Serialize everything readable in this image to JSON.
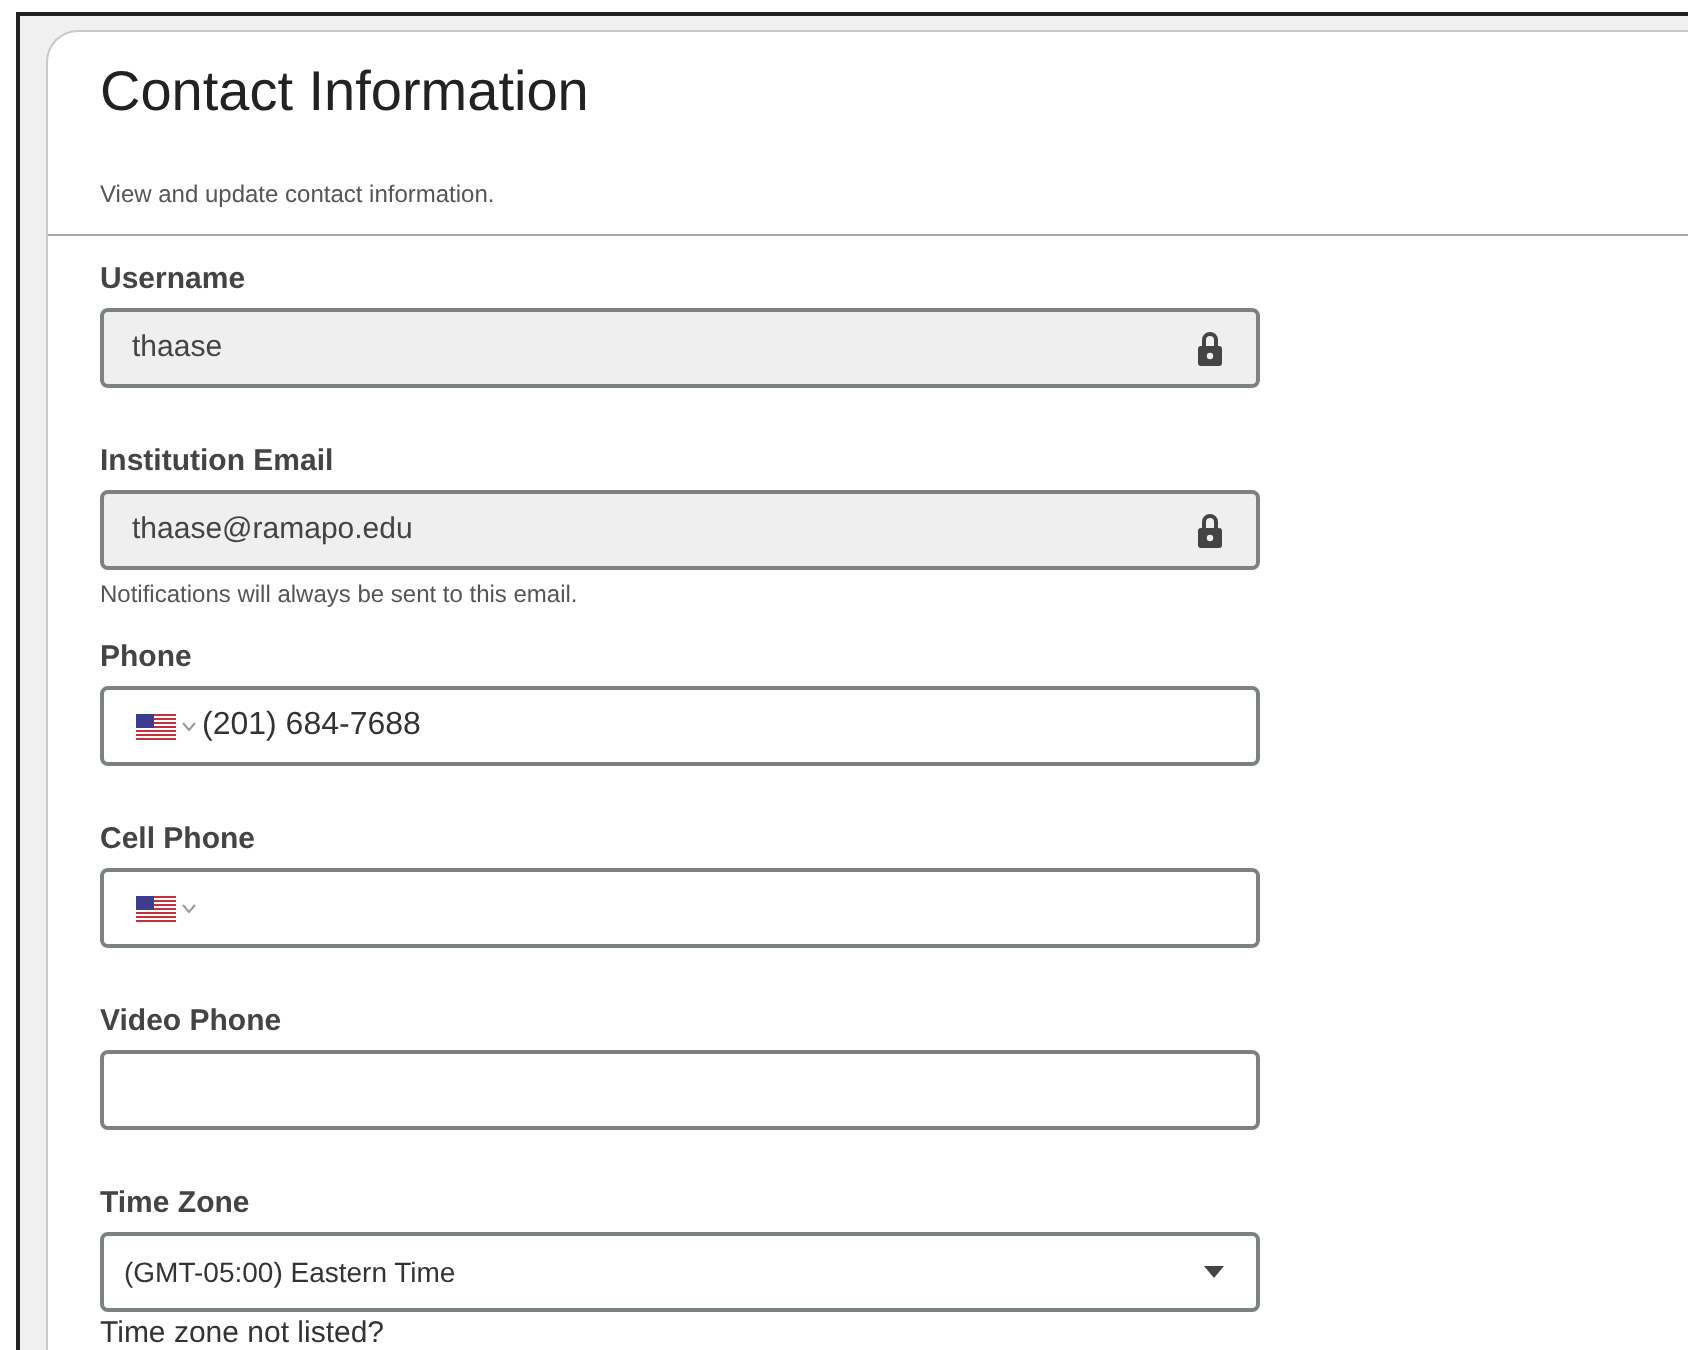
{
  "header": {
    "title": "Contact Information",
    "subtitle": "View and update contact information."
  },
  "fields": [
    {
      "kind": "locked",
      "label": "Username",
      "value": "thaase"
    },
    {
      "kind": "locked",
      "label": "Institution Email",
      "value": "thaase@ramapo.edu",
      "hint": "Notifications will always be sent to this email."
    },
    {
      "kind": "phone",
      "label": "Phone",
      "value": "(201) 684-7688"
    },
    {
      "kind": "phone",
      "label": "Cell Phone"
    },
    {
      "kind": "text",
      "label": "Video Phone"
    },
    {
      "kind": "select",
      "label": "Time Zone",
      "value": "(GMT-05:00) Eastern Time",
      "hint": "Time zone not listed?"
    }
  ]
}
